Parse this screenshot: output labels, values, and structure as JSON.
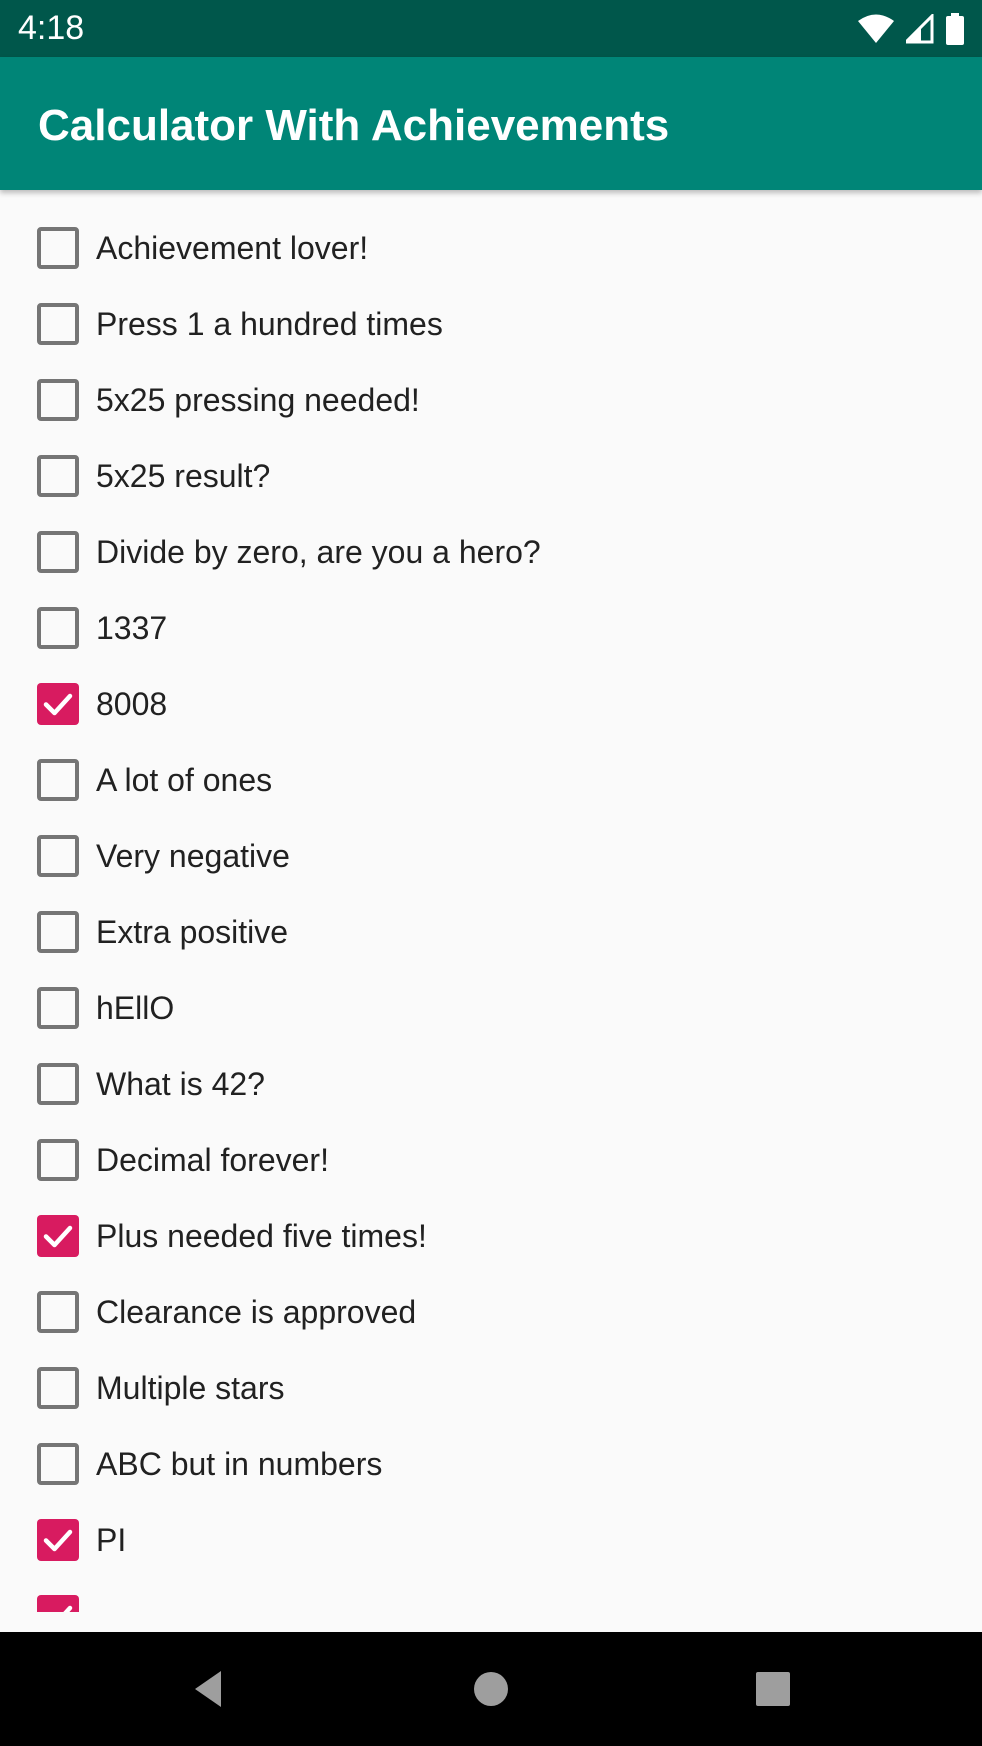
{
  "status_bar": {
    "time": "4:18",
    "icons": [
      "wifi-icon",
      "signal-icon",
      "battery-icon"
    ]
  },
  "app_bar": {
    "title": "Calculator With Achievements",
    "color": "#008577"
  },
  "colors": {
    "status_bar": "#00574b",
    "accent": "#d81b60",
    "unchecked_border": "#757575",
    "background": "#fafafa"
  },
  "achievements": [
    {
      "label": "Achievement lover!",
      "checked": false
    },
    {
      "label": "Press 1 a hundred times",
      "checked": false
    },
    {
      "label": "5x25 pressing needed!",
      "checked": false
    },
    {
      "label": "5x25 result?",
      "checked": false
    },
    {
      "label": "Divide by zero, are you a hero?",
      "checked": false
    },
    {
      "label": "1337",
      "checked": false
    },
    {
      "label": "8008",
      "checked": true
    },
    {
      "label": "A lot of ones",
      "checked": false
    },
    {
      "label": "Very negative",
      "checked": false
    },
    {
      "label": "Extra positive",
      "checked": false
    },
    {
      "label": "hEllO",
      "checked": false
    },
    {
      "label": "What is 42?",
      "checked": false
    },
    {
      "label": "Decimal forever!",
      "checked": false
    },
    {
      "label": "Plus needed five times!",
      "checked": true
    },
    {
      "label": "Clearance is approved",
      "checked": false
    },
    {
      "label": "Multiple stars",
      "checked": false
    },
    {
      "label": "ABC but in numbers",
      "checked": false
    },
    {
      "label": "PI",
      "checked": true
    },
    {
      "label": "",
      "checked": true
    }
  ],
  "nav_bar": {
    "buttons": [
      "back-icon",
      "home-icon",
      "recents-icon"
    ]
  }
}
